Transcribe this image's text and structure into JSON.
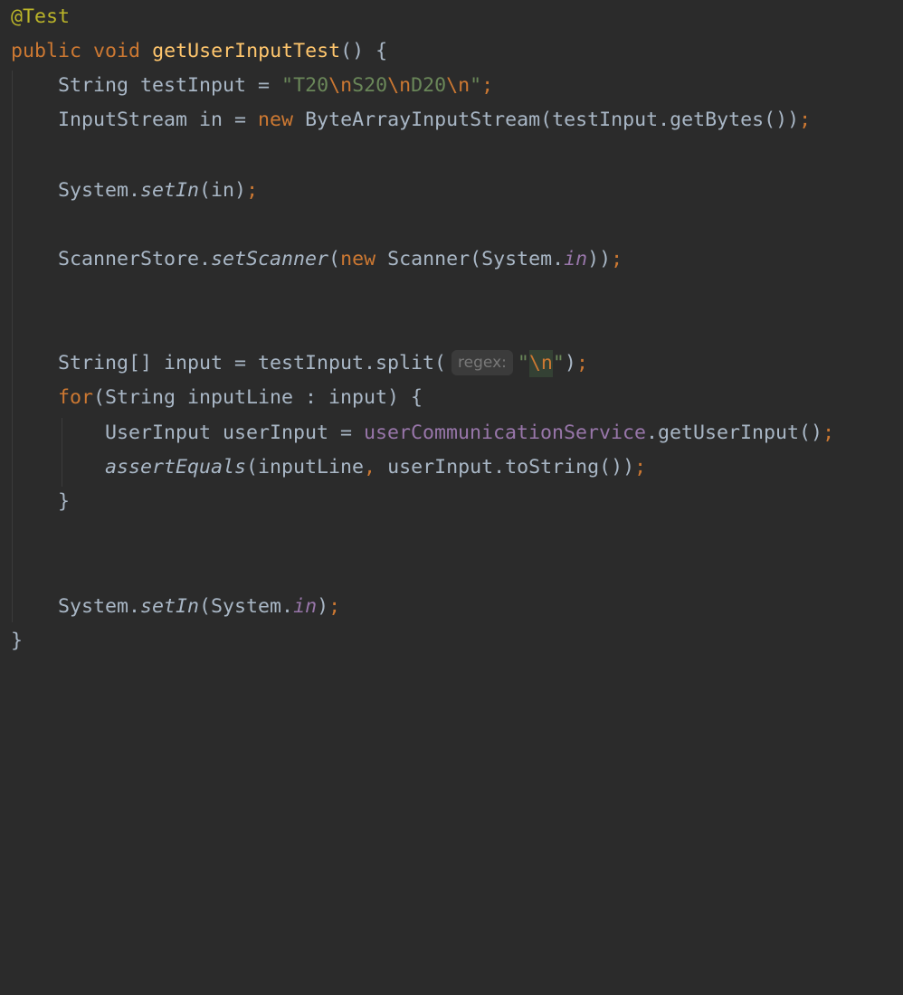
{
  "tokens": {
    "annotation": "@Test",
    "kw_public": "public",
    "kw_void": "void",
    "method_name": "getUserInputTest",
    "paren_open_brace": "() {",
    "type_string": "String",
    "var_testInput_decl": " testInput = ",
    "str_q1": "\"",
    "str_t20": "T20",
    "esc_n": "\\n",
    "str_s20": "S20",
    "str_d20": "D20",
    "str_q2": "\"",
    "semi": ";",
    "type_inputstream": "InputStream",
    "var_in_decl": " in = ",
    "kw_new": "new",
    "bais_call": " ByteArrayInputStream(testInput.getBytes())",
    "system_dot": "System.",
    "setIn": "setIn",
    "arg_in": "(in)",
    "scannerstore_dot": "ScannerStore.",
    "setScanner": "setScanner",
    "paren_open": "(",
    "scanner_system": " Scanner(System.",
    "field_in": "in",
    "close_parens": "))",
    "string_array_decl": "String[] input = testInput.split(",
    "hint_regex": "regex:",
    "split_close": ")",
    "kw_for": "for",
    "for_rest": "(String inputLine : input) {",
    "userinput_decl": "UserInput userInput = ",
    "field_service": "userCommunicationService",
    "get_user_input": ".getUserInput()",
    "assert_equals": "assertEquals",
    "assert_args_1": "(inputLine",
    "comma": ",",
    "assert_args_2": " userInput.toString())",
    "close_brace": "}",
    "system_open": "(System.",
    "close_paren": ")"
  }
}
